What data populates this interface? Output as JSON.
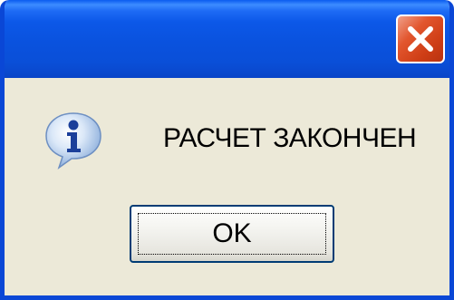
{
  "dialog": {
    "message": "РАСЧЕТ ЗАКОНЧЕН",
    "ok_label": "OK",
    "icon": "info-icon",
    "close_icon": "close-icon"
  },
  "colors": {
    "title_bar": "#0a52de",
    "frame": "#0a47d6",
    "close_button": "#d9481e",
    "body": "#ece9d8",
    "button_border": "#003c74"
  }
}
